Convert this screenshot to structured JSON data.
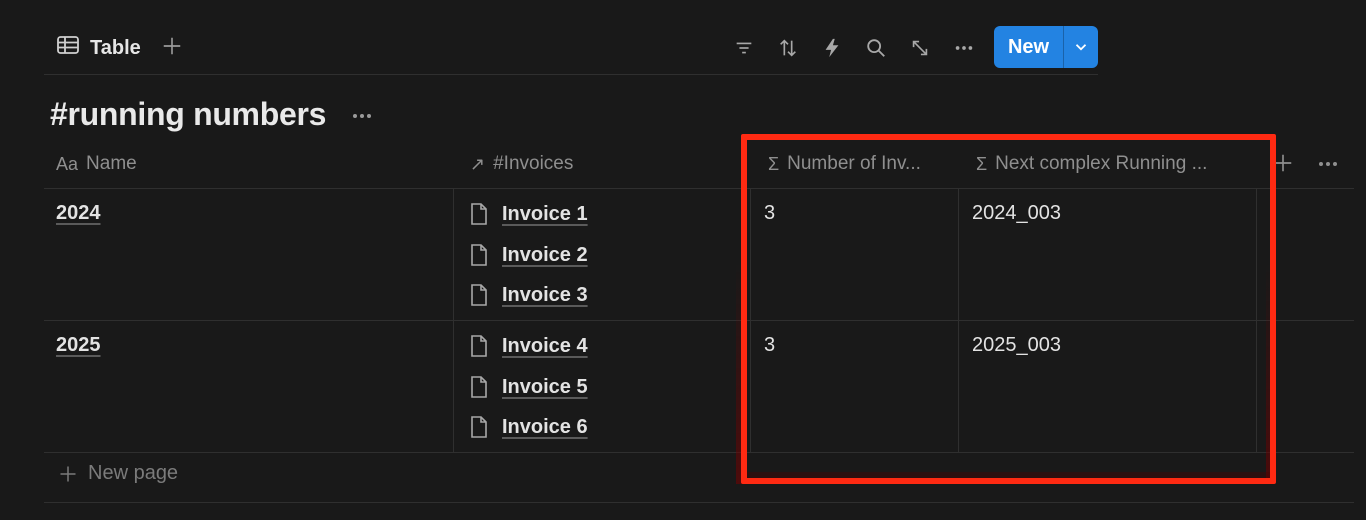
{
  "toolbar": {
    "view_label": "Table",
    "new_button_label": "New"
  },
  "database": {
    "title": "#running numbers"
  },
  "table": {
    "columns": [
      {
        "icon": "Aa",
        "label": "Name"
      },
      {
        "icon": "↗",
        "label": "#Invoices"
      },
      {
        "icon": "Σ",
        "label": "Number of Inv..."
      },
      {
        "icon": "Σ",
        "label": "Next complex Running ..."
      }
    ],
    "rows": [
      {
        "name": "2024",
        "invoices": [
          "Invoice 1",
          "Invoice 2",
          "Invoice 3"
        ],
        "number_of_invoices": "3",
        "next_running": "2024_003"
      },
      {
        "name": "2025",
        "invoices": [
          "Invoice 4",
          "Invoice 5",
          "Invoice 6"
        ],
        "number_of_invoices": "3",
        "next_running": "2025_003"
      }
    ],
    "new_page_label": "New page"
  },
  "colors": {
    "background": "#191919",
    "accent": "#2383e2",
    "highlight": "#ff2a12"
  },
  "icons": [
    "table-icon",
    "plus-icon",
    "filter-icon",
    "sort-icon",
    "automation-icon",
    "search-icon",
    "expand-icon",
    "more-icon",
    "chevron-down-icon",
    "page-icon"
  ]
}
